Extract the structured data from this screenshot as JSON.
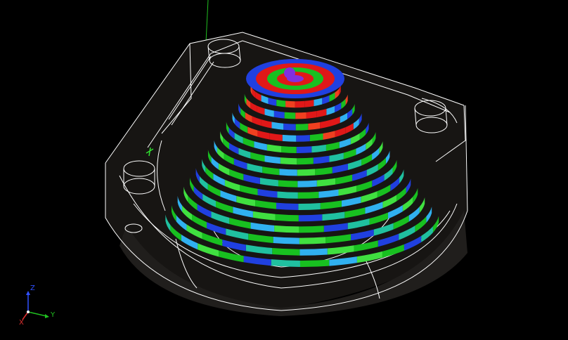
{
  "viewport": {
    "background": "#000000",
    "model": {
      "wireframe_color": "#ffffff",
      "body_color": "#1c1a18",
      "palette": {
        "red": "#e01818",
        "orange_red": "#f04020",
        "green": "#18c020",
        "light_green": "#40e040",
        "cyan": "#30b0f0",
        "blue": "#2040e0",
        "purple": "#8030e0",
        "teal": "#20c0a0"
      },
      "toolpath_layers": 16
    },
    "axis_triad": {
      "z_label": "Z",
      "y_label": "Y",
      "x_label": "X",
      "z_color": "#3050ff",
      "y_color": "#20c020",
      "x_color": "#e03030"
    }
  }
}
